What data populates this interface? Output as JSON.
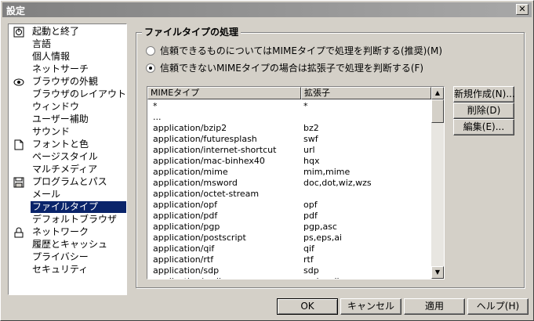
{
  "window": {
    "title": "設定",
    "close_symbol": "✕"
  },
  "sidebar": {
    "items": [
      {
        "label": "起動と終了",
        "icon": "power-icon"
      },
      {
        "label": "言語",
        "icon": ""
      },
      {
        "label": "個人情報",
        "icon": ""
      },
      {
        "label": "ネットサーチ",
        "icon": ""
      },
      {
        "label": "ブラウザの外観",
        "icon": "eye-icon"
      },
      {
        "label": "ブラウザのレイアウト",
        "icon": ""
      },
      {
        "label": "ウィンドウ",
        "icon": ""
      },
      {
        "label": "ユーザー補助",
        "icon": ""
      },
      {
        "label": "サウンド",
        "icon": ""
      },
      {
        "label": "フォントと色",
        "icon": "document-icon"
      },
      {
        "label": "ページスタイル",
        "icon": ""
      },
      {
        "label": "マルチメディア",
        "icon": ""
      },
      {
        "label": "プログラムとパス",
        "icon": "disk-icon"
      },
      {
        "label": "メール",
        "icon": ""
      },
      {
        "label": "ファイルタイプ",
        "icon": "",
        "selected": true
      },
      {
        "label": "デフォルトブラウザ",
        "icon": ""
      },
      {
        "label": "ネットワーク",
        "icon": "lock-icon"
      },
      {
        "label": "履歴とキャッシュ",
        "icon": ""
      },
      {
        "label": "プライバシー",
        "icon": ""
      },
      {
        "label": "セキュリティ",
        "icon": ""
      }
    ]
  },
  "panel": {
    "group_title": "ファイルタイプの処理",
    "radio_trusted": "信頼できるものについてはMIMEタイプで処理を判断する(推奨)(M)",
    "radio_untrusted": "信頼できないMIMEタイプの場合は拡張子で処理を判断する(F)",
    "selected_radio": "untrusted"
  },
  "list": {
    "columns": [
      "MIMEタイプ",
      "拡張子"
    ],
    "rows": [
      [
        "*",
        "*"
      ],
      [
        "...",
        ""
      ],
      [
        "application/bzip2",
        "bz2"
      ],
      [
        "application/futuresplash",
        "swf"
      ],
      [
        "application/internet-shortcut",
        "url"
      ],
      [
        "application/mac-binhex40",
        "hqx"
      ],
      [
        "application/mime",
        "mim,mime"
      ],
      [
        "application/msword",
        "doc,dot,wiz,wzs"
      ],
      [
        "application/octet-stream",
        ""
      ],
      [
        "application/opf",
        "opf"
      ],
      [
        "application/pdf",
        "pdf"
      ],
      [
        "application/pgp",
        "pgp,asc"
      ],
      [
        "application/postscript",
        "ps,eps,ai"
      ],
      [
        "application/qif",
        "qif"
      ],
      [
        "application/rtf",
        "rtf"
      ],
      [
        "application/sdp",
        "sdp"
      ],
      [
        "application/smil",
        "smi,smil"
      ]
    ],
    "scroll_up": "▲",
    "scroll_down": "▼"
  },
  "side_buttons": {
    "new": "新規作成(N)...",
    "delete": "削除(D)",
    "edit": "編集(E)..."
  },
  "footer": {
    "ok": "OK",
    "cancel": "キャンセル",
    "apply": "適用",
    "help": "ヘルプ(H)"
  },
  "colors": {
    "selection": "#0a246a",
    "face": "#d4d0c8"
  }
}
